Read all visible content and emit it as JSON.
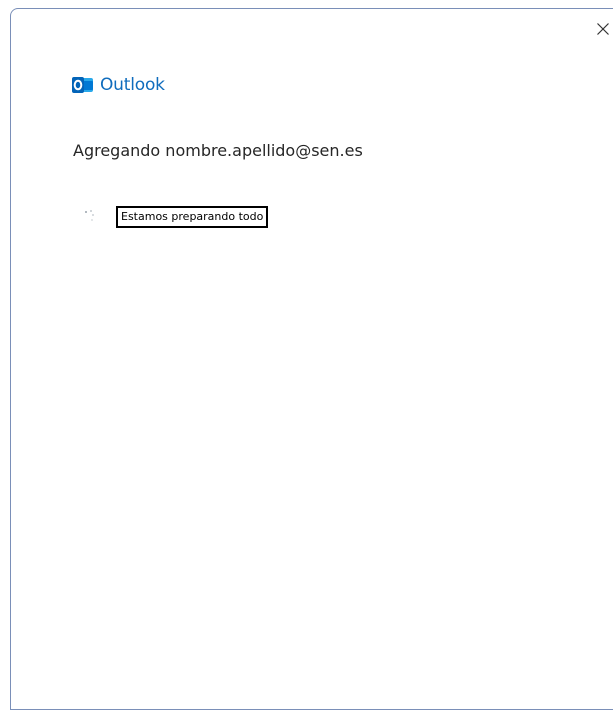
{
  "app": {
    "name": "Outlook",
    "accent_color": "#0f6cbd"
  },
  "dialog": {
    "title": "Agregando nombre.apellido@sen.es",
    "status_text": "Estamos preparando todo",
    "close_icon": "close-icon",
    "logo_icon": "outlook-logo-icon",
    "spinner_icon": "loading-spinner-icon"
  }
}
